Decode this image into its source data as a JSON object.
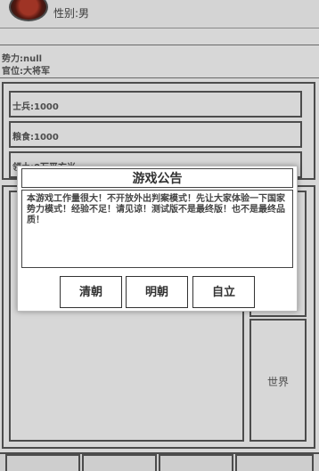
{
  "profile": {
    "gender": "性别:男"
  },
  "info": {
    "faction": "势力:null",
    "rank": "官位:大将军"
  },
  "resources": [
    {
      "label": "士兵:1000"
    },
    {
      "label": "粮食:1000"
    },
    {
      "label": "领土:0万平方米"
    }
  ],
  "map": {
    "world_label": "世界"
  },
  "modal": {
    "title": "游戏公告",
    "body": "本游戏工作量很大！不开放外出判案模式！先让大家体验一下国家势力模式！经验不足！请见谅！测试版不是最终版！也不是最终品质！",
    "buttons": [
      "清朝",
      "明朝",
      "自立"
    ]
  }
}
